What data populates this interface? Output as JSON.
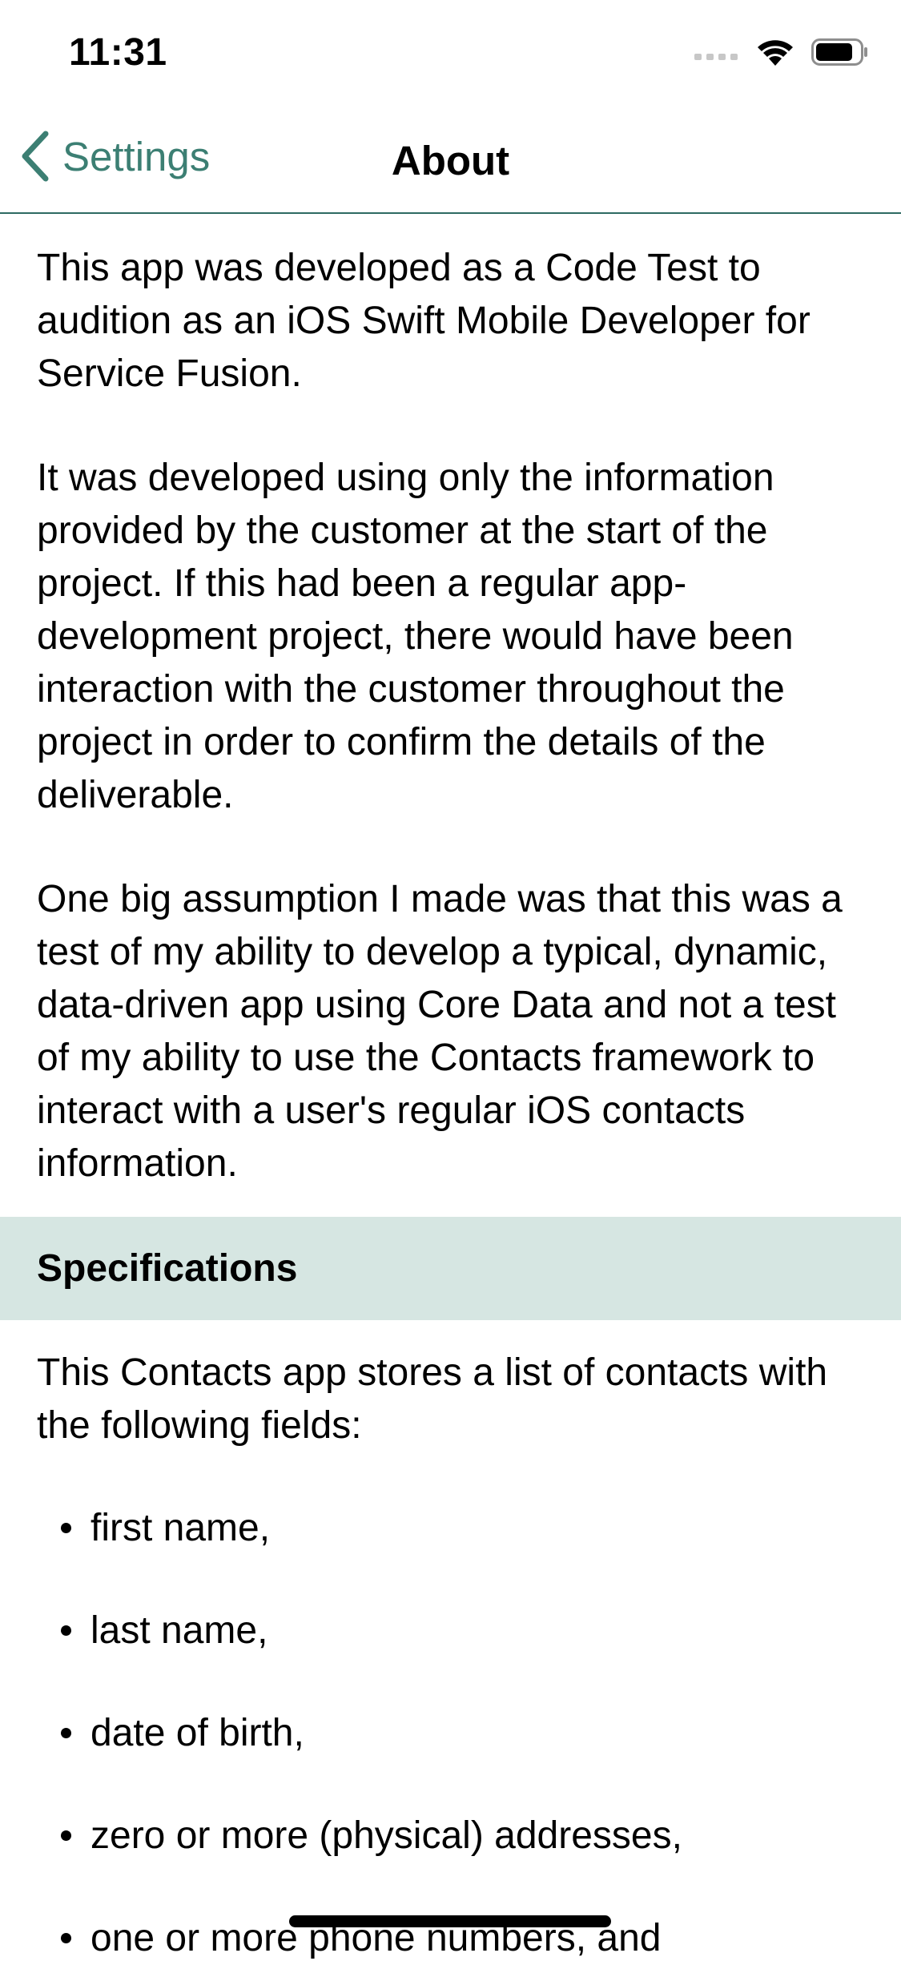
{
  "status_bar": {
    "time": "11:31"
  },
  "nav": {
    "back_label": "Settings",
    "title": "About",
    "accent_color": "#3c7f73"
  },
  "content": {
    "paragraphs": [
      "This app was developed as a Code Test to audition as an iOS Swift Mobile Developer for Service Fusion.",
      "It was developed using only the information provided by the customer at the start of the project. If this had been a regular app-development project, there would have been interaction with the customer throughout the project in order to confirm the details of the deliverable.",
      "One big assumption I made was that this was a test of my ability to develop a typical, dynamic, data-driven app using Core Data and not a test of my ability to use the Contacts framework to interact with a user's regular iOS contacts information."
    ],
    "section_header": "Specifications",
    "section_header_bg": "#d6e6e2",
    "spec_intro": "This Contacts app stores a list of contacts with the following fields:",
    "fields": [
      "first name,",
      "last name,",
      "date of birth,",
      "zero or more (physical) addresses,",
      "one or more phone numbers, and"
    ]
  },
  "icons": {
    "back": "chevron-left-icon",
    "signal": "cellular-signal-icon",
    "wifi": "wifi-icon",
    "battery": "battery-icon"
  }
}
